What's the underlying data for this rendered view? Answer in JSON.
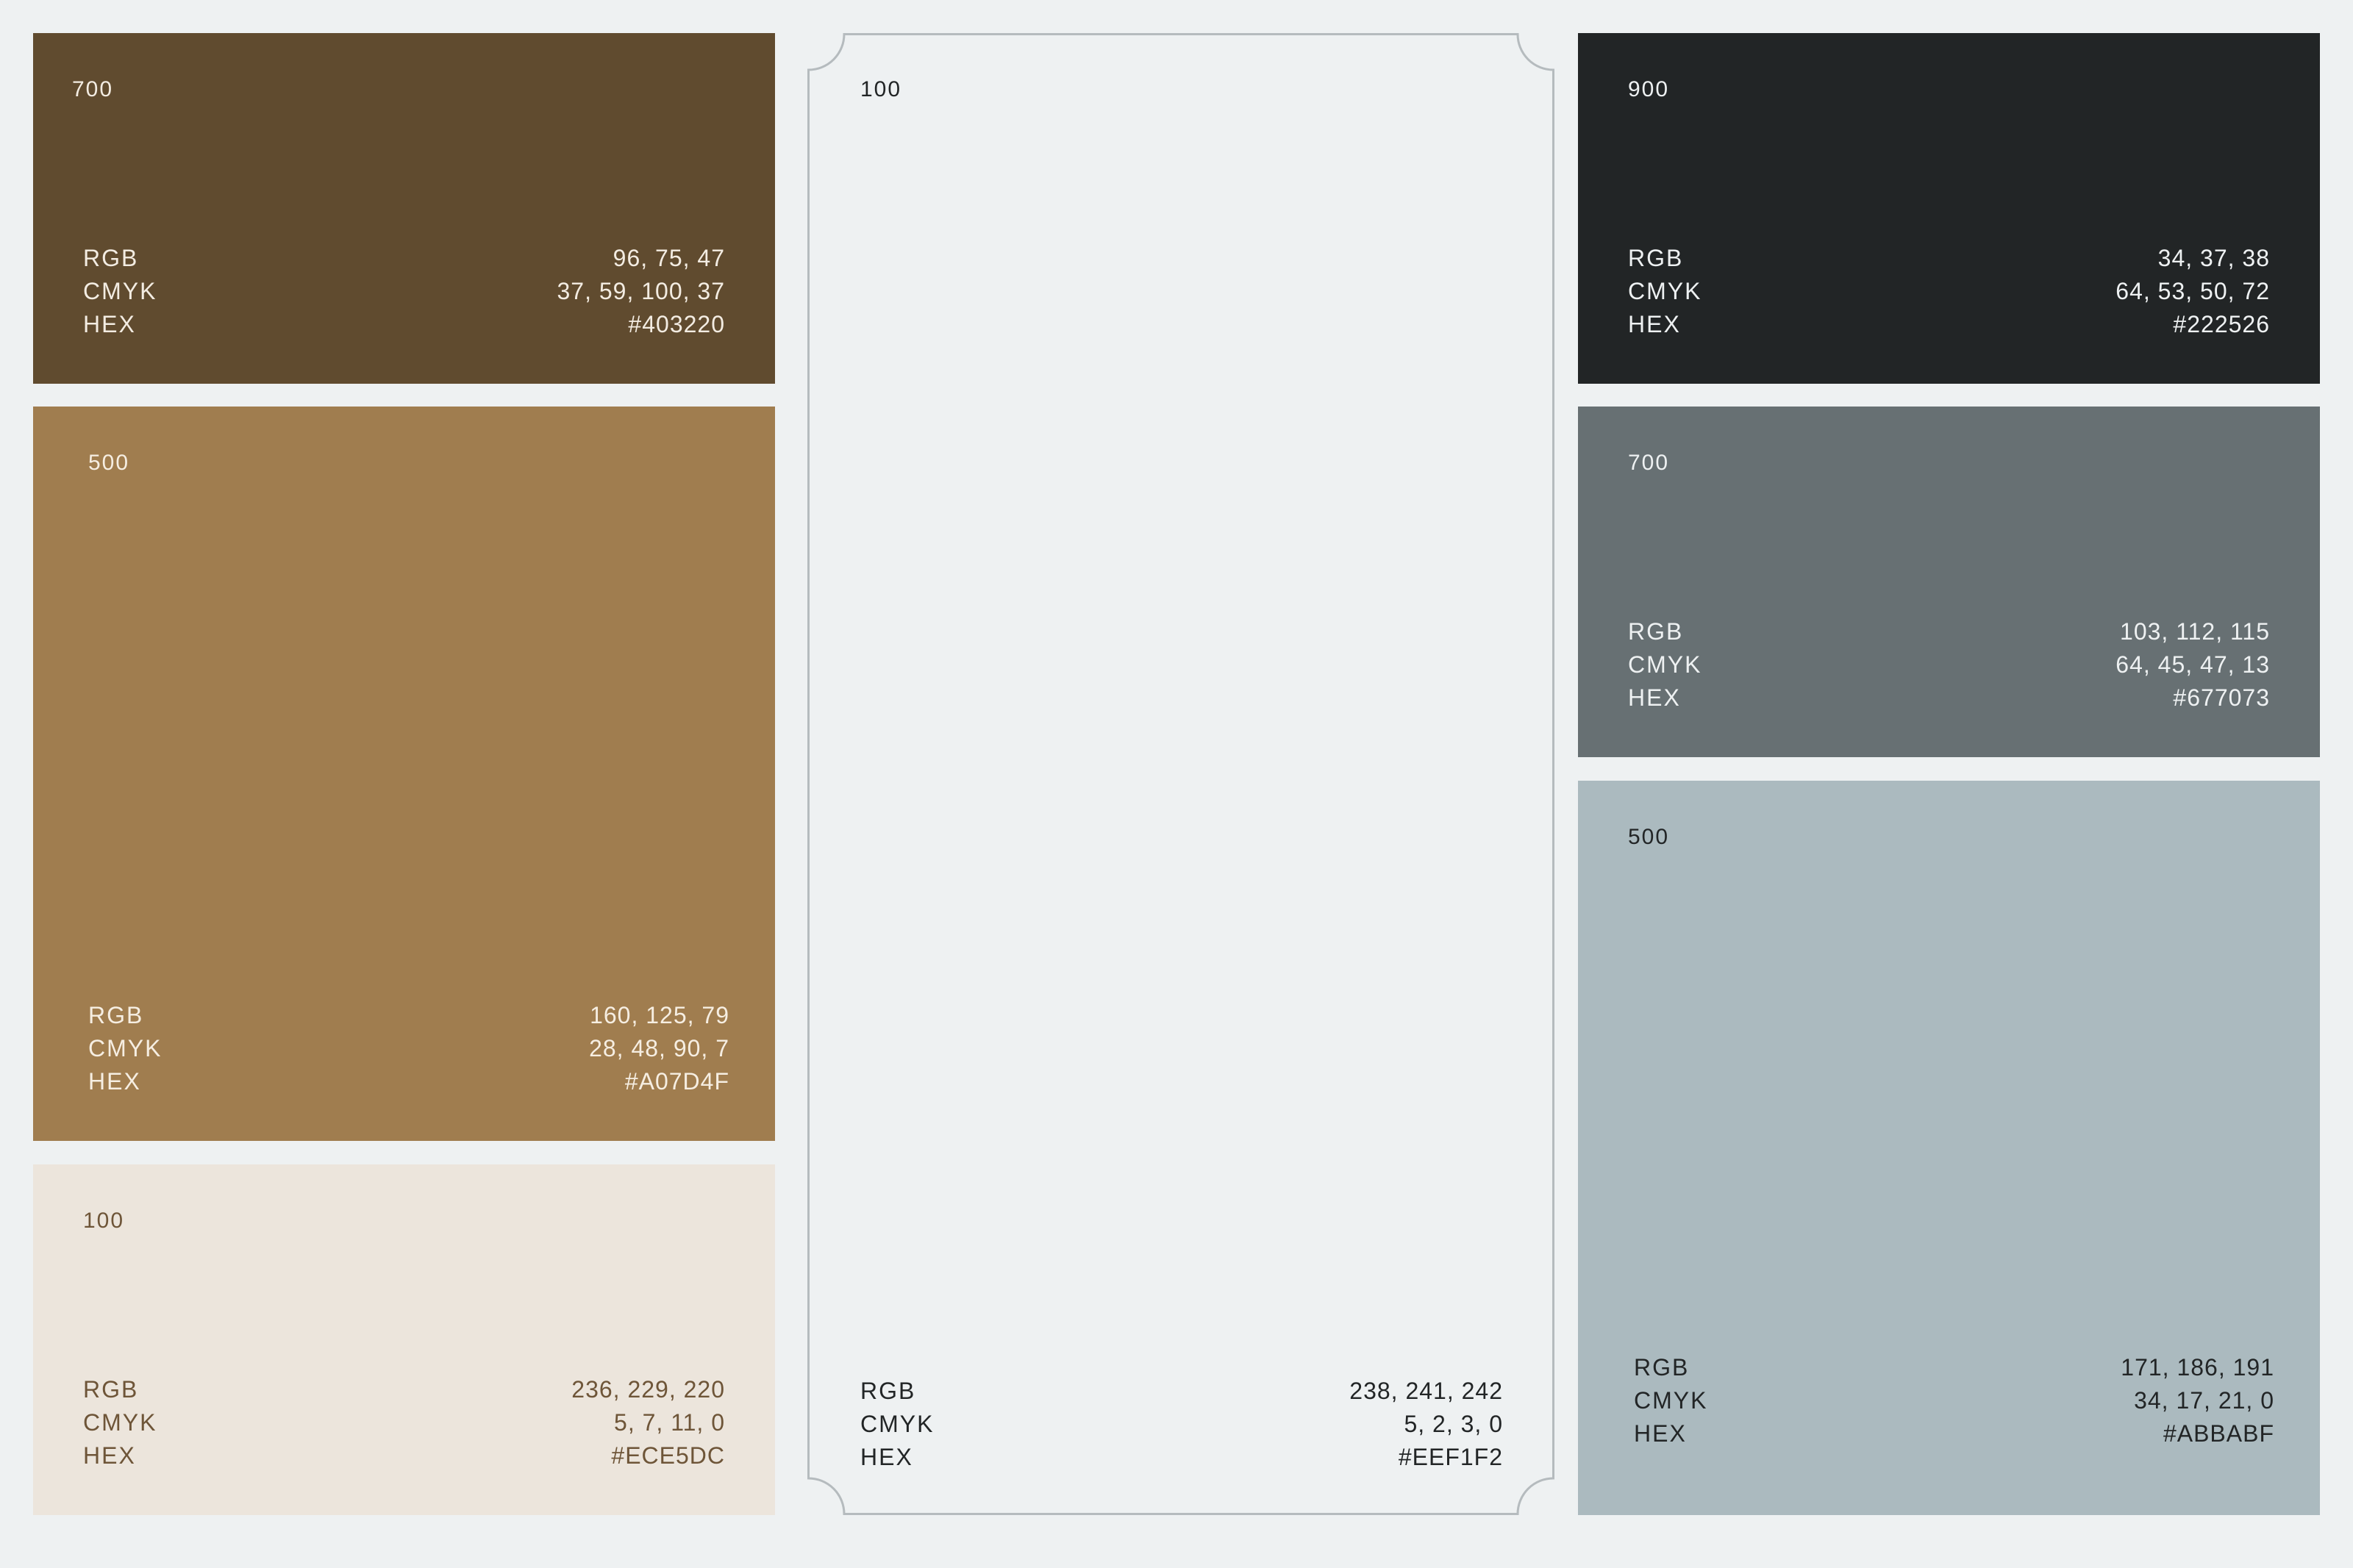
{
  "labels": {
    "rgb": "RGB",
    "cmyk": "CMYK",
    "hex": "HEX"
  },
  "swatches": {
    "brown_700": {
      "shade": "700",
      "rgb": "96, 75, 47",
      "cmyk": "37, 59, 100, 37",
      "hex": "#403220",
      "fill": "#604B2F",
      "text": "#F3ECE2"
    },
    "brown_500": {
      "shade": "500",
      "rgb": "160, 125, 79",
      "cmyk": "28, 48, 90, 7",
      "hex": "#A07D4F",
      "fill": "#A07D4F",
      "text": "#F6EEE2"
    },
    "brown_100": {
      "shade": "100",
      "rgb": "236, 229, 220",
      "cmyk": "5, 7, 11, 0",
      "hex": "#ECE5DC",
      "fill": "#ECE5DC",
      "text": "#6E5538"
    },
    "neutral_100": {
      "shade": "100",
      "rgb": "238, 241, 242",
      "cmyk": "5, 2, 3, 0",
      "hex": "#EEF1F2",
      "fill": "#EEF1F2",
      "text": "#222526",
      "border": "#B5BBBE"
    },
    "gray_900": {
      "shade": "900",
      "rgb": "34, 37, 38",
      "cmyk": "64, 53, 50, 72",
      "hex": "#222526",
      "fill": "#222526",
      "text": "#EEF1F2"
    },
    "gray_700": {
      "shade": "700",
      "rgb": "103, 112, 115",
      "cmyk": "64, 45, 47, 13",
      "hex": "#677073",
      "fill": "#677073",
      "text": "#EEF1F2"
    },
    "gray_500": {
      "shade": "500",
      "rgb": "171, 186, 191",
      "cmyk": "34, 17, 21, 0",
      "hex": "#ABBABF",
      "fill": "#ABBABF",
      "text": "#222526"
    }
  }
}
